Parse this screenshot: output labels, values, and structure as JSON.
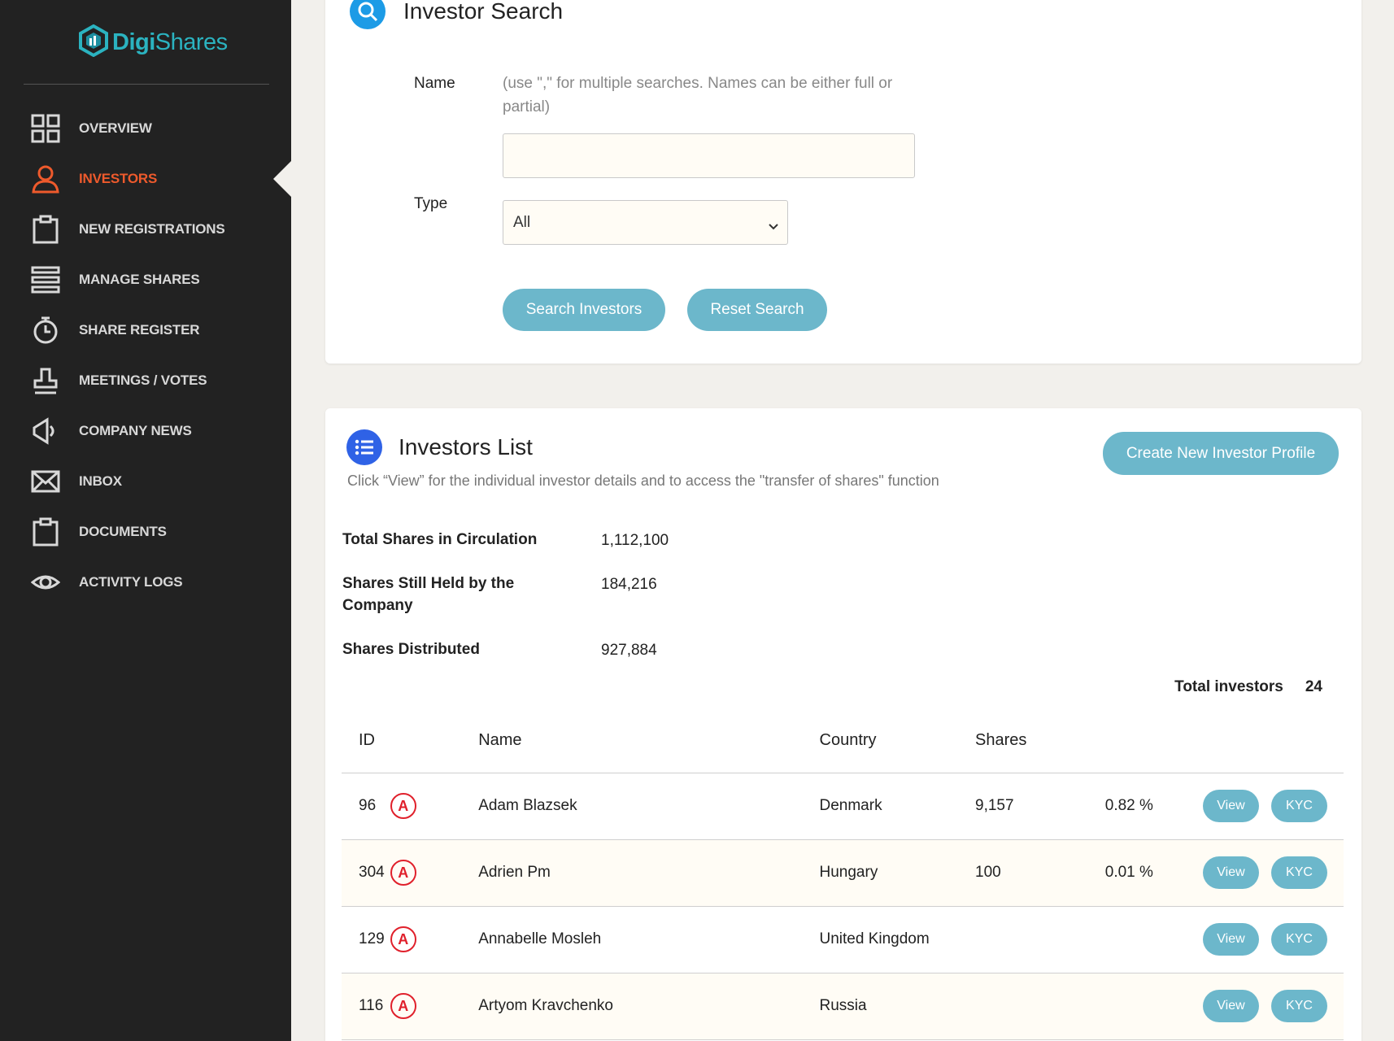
{
  "brand": {
    "part1": "Digi",
    "part2": "Shares",
    "color": "#2bb3c0"
  },
  "sidebar": {
    "items": [
      {
        "label": "OVERVIEW",
        "icon": "grid-icon",
        "active": false
      },
      {
        "label": "INVESTORS",
        "icon": "user-icon",
        "active": true
      },
      {
        "label": "NEW REGISTRATIONS",
        "icon": "clipboard-icon",
        "active": false
      },
      {
        "label": "MANAGE SHARES",
        "icon": "list-icon",
        "active": false
      },
      {
        "label": "SHARE REGISTER",
        "icon": "stopwatch-icon",
        "active": false
      },
      {
        "label": "MEETINGS / VOTES",
        "icon": "stamp-icon",
        "active": false
      },
      {
        "label": "COMPANY NEWS",
        "icon": "megaphone-icon",
        "active": false
      },
      {
        "label": "INBOX",
        "icon": "envelope-icon",
        "active": false
      },
      {
        "label": "DOCUMENTS",
        "icon": "clipboard-icon",
        "active": false
      },
      {
        "label": "ACTIVITY LOGS",
        "icon": "eye-icon",
        "active": false
      }
    ],
    "active_color": "#ee5a2c"
  },
  "search": {
    "title": "Investor Search",
    "name_label": "Name",
    "name_hint": "(use \",\" for multiple searches. Names can be either full or partial)",
    "name_value": "",
    "type_label": "Type",
    "type_value": "All",
    "search_button": "Search Investors",
    "reset_button": "Reset Search"
  },
  "list": {
    "title": "Investors List",
    "create_button": "Create New Investor Profile",
    "subtitle": "Click “View” for the individual investor details and to access the \"transfer of shares\" function",
    "stats": [
      {
        "label": "Total Shares in Circulation",
        "value": "1,112,100"
      },
      {
        "label": "Shares Still Held by the Company",
        "value": "184,216"
      },
      {
        "label": "Shares Distributed",
        "value": "927,884"
      }
    ],
    "total_label": "Total investors",
    "total_value": "24",
    "columns": {
      "id": "ID",
      "name": "Name",
      "country": "Country",
      "shares": "Shares"
    },
    "badge_letter": "A",
    "view_label": "View",
    "kyc_label": "KYC",
    "rows": [
      {
        "id": "96",
        "name": "Adam Blazsek",
        "country": "Denmark",
        "shares": "9,157",
        "pct": "0.82 %"
      },
      {
        "id": "304",
        "name": "Adrien Pm",
        "country": "Hungary",
        "shares": "100",
        "pct": "0.01 %"
      },
      {
        "id": "129",
        "name": "Annabelle Mosleh",
        "country": "United Kingdom",
        "shares": "",
        "pct": ""
      },
      {
        "id": "116",
        "name": "Artyom Kravchenko",
        "country": "Russia",
        "shares": "",
        "pct": ""
      }
    ]
  },
  "colors": {
    "sidebar_bg": "#222222",
    "button": "#6cb7cb",
    "badge": "#e0202b",
    "title_icon": "#2f62e6"
  }
}
